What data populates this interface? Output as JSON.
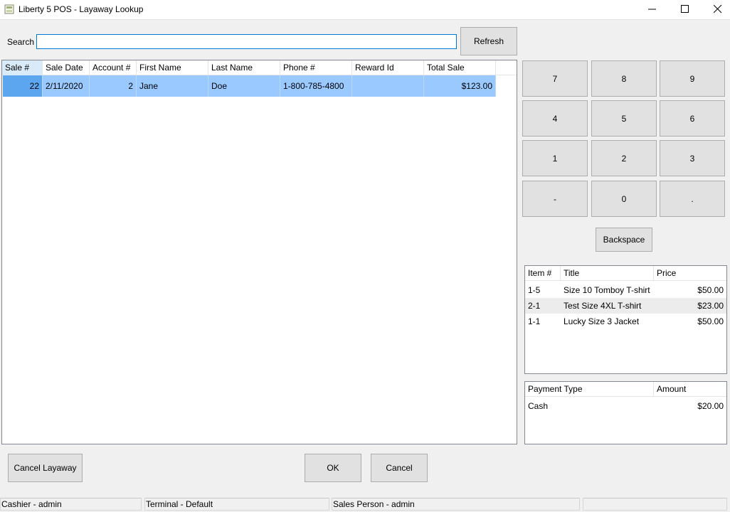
{
  "window": {
    "title": "Liberty 5 POS - Layaway Lookup",
    "controls": [
      "minimize-icon",
      "maximize-icon",
      "close-icon"
    ]
  },
  "search": {
    "label": "Search",
    "value": "",
    "refresh_label": "Refresh"
  },
  "layaway_grid": {
    "columns": [
      "Sale #",
      "Sale Date",
      "Account #",
      "First Name",
      "Last Name",
      "Phone #",
      "Reward Id",
      "Total Sale"
    ],
    "rows": [
      {
        "sale_no": "22",
        "sale_date": "2/11/2020",
        "account_no": "2",
        "first_name": "Jane",
        "last_name": "Doe",
        "phone": "1-800-785-4800",
        "reward_id": "",
        "total_sale": "$123.00"
      }
    ]
  },
  "keypad": {
    "keys": [
      "7",
      "8",
      "9",
      "4",
      "5",
      "6",
      "1",
      "2",
      "3",
      "-",
      "0",
      "."
    ],
    "backspace_label": "Backspace"
  },
  "items_grid": {
    "columns": [
      "Item #",
      "Title",
      "Price"
    ],
    "rows": [
      {
        "item_no": "1-5",
        "title": "Size 10 Tomboy T-shirt",
        "price": "$50.00"
      },
      {
        "item_no": "2-1",
        "title": "Test Size 4XL T-shirt",
        "price": "$23.00"
      },
      {
        "item_no": "1-1",
        "title": "Lucky Size 3 Jacket",
        "price": "$50.00"
      }
    ]
  },
  "payments_grid": {
    "columns": [
      "Payment Type",
      "Amount"
    ],
    "rows": [
      {
        "type": "Cash",
        "amount": "$20.00"
      }
    ]
  },
  "buttons": {
    "cancel_layaway": "Cancel Layaway",
    "ok": "OK",
    "cancel": "Cancel"
  },
  "status": {
    "cashier": "Cashier - admin",
    "terminal": "Terminal - Default",
    "sales_person": "Sales Person - admin",
    "extra": ""
  },
  "colors": {
    "selection": "#99c9ff",
    "selection_focus": "#5ba6ef",
    "focus_border": "#0078d7",
    "button_face": "#e1e1e1"
  }
}
